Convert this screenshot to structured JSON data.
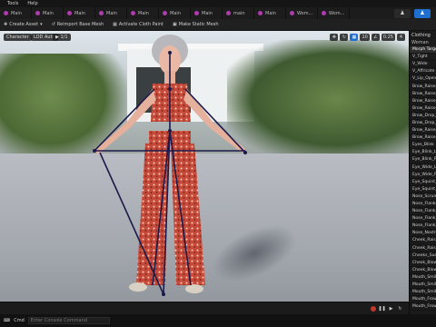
{
  "menu": {
    "items": [
      "Tools",
      "Help"
    ]
  },
  "tabs": [
    "Main",
    "Main",
    "Main",
    "Main",
    "Main",
    "Main",
    "Main",
    "main",
    "Main",
    "Wom...",
    "Wom..."
  ],
  "toolbar": {
    "create_asset": "Create Asset",
    "reimport": "Reimport Base Mesh",
    "activate_cloth": "Activate Cloth Paint",
    "make_static": "Make Static Mesh"
  },
  "viewport": {
    "mode": "Character",
    "lod": "LOD Auto",
    "speed": "1/1",
    "angle": "10",
    "scale": "0.25",
    "speed_value": "4",
    "colors": {
      "accent": "#1f6fd0"
    }
  },
  "right_panel": {
    "header": "Clothing",
    "subheader": "Woman",
    "items": [
      "Morph Targets",
      "V_Tight",
      "V_Wide",
      "V_Affricate",
      "V_Lip_Open",
      "Brow_Raise_I",
      "Brow_Raise_I",
      "Brow_Raise_O",
      "Brow_Raise_O",
      "Brow_Drop_L",
      "Brow_Drop_R",
      "Brow_Raise_L",
      "Brow_Raise_R",
      "Eyes_Blink",
      "Eye_Blink_L",
      "Eye_Blink_R",
      "Eye_Wide_L",
      "Eye_Wide_R",
      "Eye_Squint_L",
      "Eye_Squint_R",
      "Nose_Scrunch",
      "Nose_Flanks",
      "Nose_Flank_R",
      "Nose_Flank_L",
      "Nose_Flank_R",
      "Nose_Nostril",
      "Cheek_Raise",
      "Cheek_Raise",
      "Cheeks_Suck",
      "Cheek_Blow",
      "Cheek_Blow",
      "Mouth_Smile",
      "Mouth_Smile",
      "Mouth_Smile",
      "Mouth_Frown",
      "Mouth_Frown"
    ]
  },
  "statusbar": {
    "cmd_label": "Cmd",
    "cmd_placeholder": "Enter Console Command"
  }
}
